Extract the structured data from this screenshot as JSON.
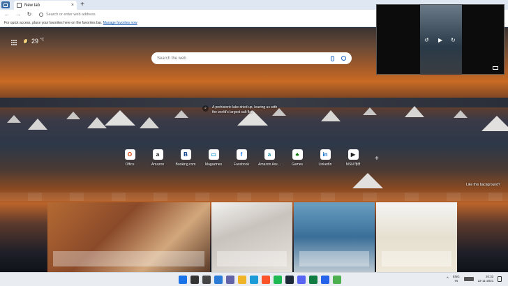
{
  "browser": {
    "tab_title": "New tab",
    "address_placeholder": "Search or enter web address",
    "favorites_hint": "For quick access, place your favorites here on the favorites bar.",
    "favorites_link": "Manage favorites now"
  },
  "newtab": {
    "temperature": "29",
    "temperature_unit": "°C",
    "search_placeholder": "Search the web",
    "image_caption": "A prehistoric lake dried up, leaving us with the world's largest salt flat",
    "like_background": "Like this background?",
    "quick_links": [
      {
        "label": "Office",
        "icon": "office-icon",
        "glyph": "O",
        "color": "#d83b01"
      },
      {
        "label": "Amazon",
        "icon": "amazon-icon",
        "glyph": "a",
        "color": "#111111"
      },
      {
        "label": "Booking.com",
        "icon": "booking-icon",
        "glyph": "B",
        "color": "#003580"
      },
      {
        "label": "Magazines",
        "icon": "magazines-icon",
        "glyph": "▭",
        "color": "#1a9bd7"
      },
      {
        "label": "Facebook",
        "icon": "facebook-icon",
        "glyph": "f",
        "color": "#1877f2"
      },
      {
        "label": "Amazon Ass...",
        "icon": "amazon-assistant-icon",
        "glyph": "a",
        "color": "#1a8fa8"
      },
      {
        "label": "Games",
        "icon": "games-icon",
        "glyph": "♣",
        "color": "#107c10"
      },
      {
        "label": "LinkedIn",
        "icon": "linkedin-icon",
        "glyph": "in",
        "color": "#0a66c2"
      },
      {
        "label": "MSN हिंदी",
        "icon": "msn-icon",
        "glyph": "▶",
        "color": "#222222"
      }
    ]
  },
  "taskbar": {
    "lang_top": "ENG",
    "lang_bottom": "IN",
    "time": "20:32",
    "date": "22-11-2021",
    "icons": [
      {
        "name": "start-icon",
        "color": "#1a73e8"
      },
      {
        "name": "search-icon",
        "color": "#333333"
      },
      {
        "name": "task-view-icon",
        "color": "#444444"
      },
      {
        "name": "widgets-icon",
        "color": "#2a7ad6"
      },
      {
        "name": "chat-icon",
        "color": "#6264a7"
      },
      {
        "name": "file-explorer-icon",
        "color": "#f0b429"
      },
      {
        "name": "edge-icon",
        "color": "#1a9bd7"
      },
      {
        "name": "brave-icon",
        "color": "#fb542b"
      },
      {
        "name": "spotify-icon",
        "color": "#1db954"
      },
      {
        "name": "steam-icon",
        "color": "#1b2838"
      },
      {
        "name": "discord-icon",
        "color": "#5865f2"
      },
      {
        "name": "excel-icon",
        "color": "#107c41"
      },
      {
        "name": "store-icon",
        "color": "#2563eb"
      },
      {
        "name": "chrome-icon",
        "color": "#4caf50"
      }
    ]
  }
}
